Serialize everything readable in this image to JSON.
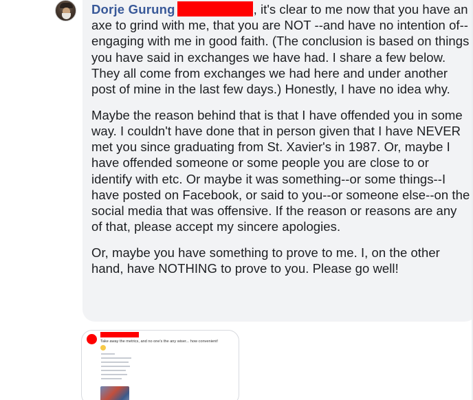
{
  "comment": {
    "author": "Dorje Gurung",
    "paragraphs": {
      "p1_after_name": ", it's clear to me now that you have an axe to grind with me, that you are NOT --and have no intention of--engaging with me in good faith. (The conclusion is based on things you have said in exchanges we have had. I share a few below. They all come from exchanges we had here and under another post of mine in the last few days.) Honestly, I have no idea why.",
      "p2": "Maybe the reason behind that is that I have offended you in some way. I couldn't have done that in person given that I have NEVER met you since graduating from St. Xavier's in 1987. Or, maybe I have offended someone or some people you are close to or identify with etc. Or maybe it was something--or some things--I have posted on Facebook, or said to you--or someone else--on the social media that was offensive. If the reason or reasons are any of that, please accept my sincere apologies.",
      "p3": "Or, maybe you have something to prove to me. I, on the other hand, have NOTHING to prove to you. Please go well!"
    }
  },
  "attachment": {
    "caption": "Take away the metrics, and no one's the any wiser... how convenient!"
  },
  "colors": {
    "bubble_bg": "#f2f3f5",
    "author_link": "#385898",
    "redaction": "#ff0000",
    "text": "#1c1e21"
  },
  "icons": {
    "avatar": "profile-photo",
    "attachment_avatar": "redacted-profile-photo"
  }
}
